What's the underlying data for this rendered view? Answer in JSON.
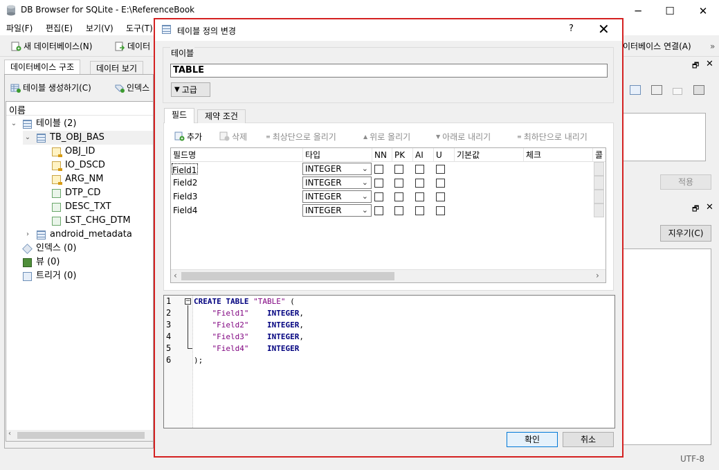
{
  "window": {
    "title": "DB Browser for SQLite - E:\\ReferenceBook",
    "minimize": "─",
    "maximize": "☐",
    "close": "✕"
  },
  "menu": [
    "파일(F)",
    "편집(E)",
    "보기(V)",
    "도구(T)"
  ],
  "toolbar": {
    "new_db": "새 데이터베이스(N)",
    "open_db": "데이터",
    "attach_db": "이터베이스 연결(A)",
    "overflow": "»"
  },
  "left": {
    "tabs": [
      "데이터베이스 구조",
      "데이터 보기"
    ],
    "create_table": "테이블 생성하기(C)",
    "create_index": "인덱스",
    "tree_header": "이름",
    "tree": {
      "tables_label": "테이블 (2)",
      "table1": "TB_OBJ_BAS",
      "fields": [
        "OBJ_ID",
        "IO_DSCD",
        "ARG_NM",
        "DTP_CD",
        "DESC_TXT",
        "LST_CHG_DTM"
      ],
      "table2": "android_metadata",
      "indexes": "인덱스 (0)",
      "views": "뷰 (0)",
      "triggers": "트리거 (0)"
    }
  },
  "right": {
    "apply": "적용",
    "clear": "지우기(C)",
    "encoding": "UTF-8"
  },
  "dialog": {
    "title": "테이블 정의 변경",
    "help": "?",
    "close": "✕",
    "table_group_label": "테이블",
    "table_name": "TABLE",
    "advanced": "고급",
    "tabs": {
      "fields": "필드",
      "constraints": "제약 조건"
    },
    "field_toolbar": {
      "add": "추가",
      "remove": "삭제",
      "move_top": "최상단으로 올리기",
      "move_up": "위로 올리기",
      "move_down": "아래로 내리기",
      "move_bottom": "최하단으로 내리기"
    },
    "columns": [
      "필드명",
      "타입",
      "NN",
      "PK",
      "AI",
      "U",
      "기본값",
      "체크",
      "콜"
    ],
    "fields": [
      {
        "name": "Field1",
        "type": "INTEGER",
        "nn": false,
        "pk": false,
        "ai": false,
        "u": false
      },
      {
        "name": "Field2",
        "type": "INTEGER",
        "nn": false,
        "pk": false,
        "ai": false,
        "u": false
      },
      {
        "name": "Field3",
        "type": "INTEGER",
        "nn": false,
        "pk": false,
        "ai": false,
        "u": false
      },
      {
        "name": "Field4",
        "type": "INTEGER",
        "nn": false,
        "pk": false,
        "ai": false,
        "u": false
      }
    ],
    "sql": {
      "line_numbers": [
        "1",
        "2",
        "3",
        "4",
        "5",
        "6"
      ],
      "create": "CREATE TABLE",
      "table": "\"TABLE\"",
      "open": " (",
      "fields": [
        {
          "name": "\"Field1\"",
          "type": "INTEGER",
          "end": ","
        },
        {
          "name": "\"Field2\"",
          "type": "INTEGER",
          "end": ","
        },
        {
          "name": "\"Field3\"",
          "type": "INTEGER",
          "end": ","
        },
        {
          "name": "\"Field4\"",
          "type": "INTEGER",
          "end": ""
        }
      ],
      "close": ");"
    },
    "ok": "확인",
    "cancel": "취소"
  }
}
